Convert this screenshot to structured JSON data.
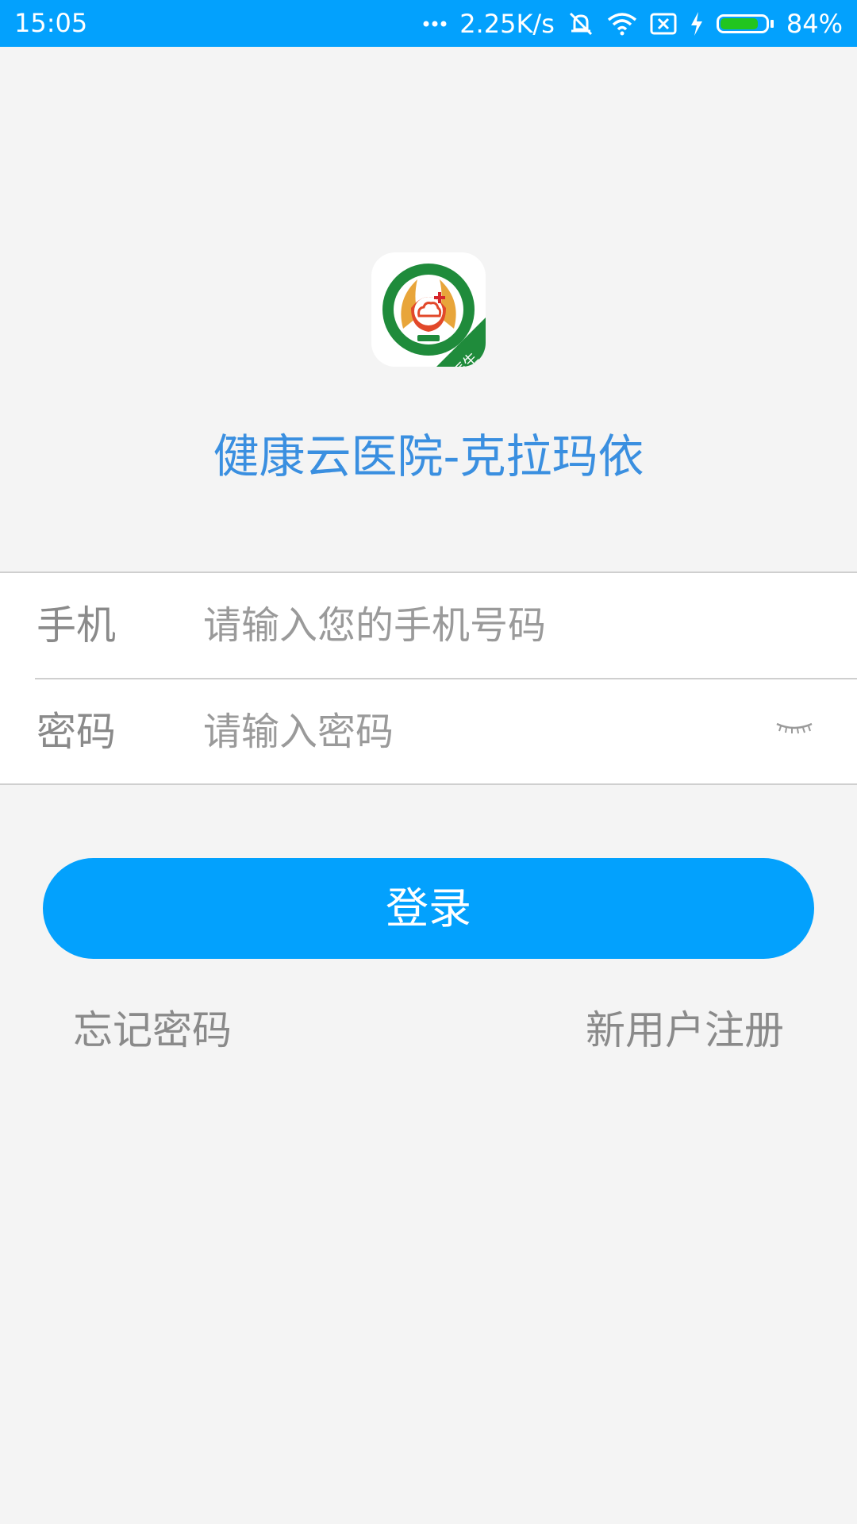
{
  "status_bar": {
    "time": "15:05",
    "network_speed": "2.25K/s",
    "battery_percent": "84%",
    "battery_level": 0.84,
    "icons": [
      "more-dots-icon",
      "mute-vibrate-icon",
      "wifi-icon",
      "no-sim-icon",
      "charging-icon",
      "battery-icon"
    ]
  },
  "app": {
    "title": "健康云医院-克拉玛依",
    "logo_badge": "医生",
    "logo_icon": "hospital-logo-icon",
    "accent_color": "#03a1fd",
    "title_color": "#3a8fe0"
  },
  "form": {
    "phone": {
      "label": "手机",
      "placeholder": "请输入您的手机号码",
      "value": ""
    },
    "password": {
      "label": "密码",
      "placeholder": "请输入密码",
      "value": "",
      "toggle_icon": "eye-closed-icon"
    }
  },
  "actions": {
    "login_label": "登录",
    "forgot_label": "忘记密码",
    "register_label": "新用户注册"
  }
}
